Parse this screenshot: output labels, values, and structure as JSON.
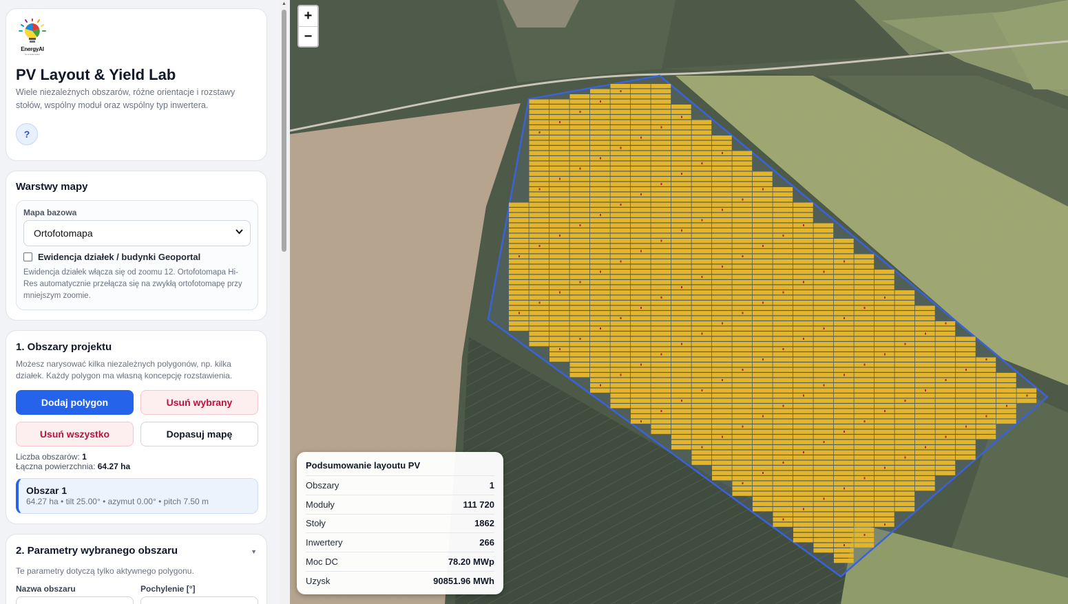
{
  "brand": {
    "logo_text": "EnergyAI",
    "logo_tagline": "for a solar better"
  },
  "header": {
    "title": "PV Layout & Yield Lab",
    "description": "Wiele niezależnych obszarów, różne orientacje i rozstawy stołów, wspólny moduł oraz wspólny typ inwertera.",
    "help_label": "?"
  },
  "layers": {
    "title": "Warstwy mapy",
    "basemap_label": "Mapa bazowa",
    "basemap_value": "Ortofotomapa",
    "cadastre_label": "Ewidencja działek / budynki Geoportal",
    "cadastre_checked": false,
    "hint": "Ewidencja działek włącza się od zoomu 12. Ortofotomapa Hi-Res automatycznie przełącza się na zwykłą ortofotomapę przy mniejszym zoomie."
  },
  "areas": {
    "title": "1. Obszary projektu",
    "description": "Możesz narysować kilka niezależnych polygonów, np. kilka działek. Każdy polygon ma własną koncepcję rozstawienia.",
    "buttons": {
      "add": "Dodaj polygon",
      "remove_selected": "Usuń wybrany",
      "remove_all": "Usuń wszystko",
      "fit_map": "Dopasuj mapę"
    },
    "count_label": "Liczba obszarów:",
    "count_value": "1",
    "total_area_label": "Łączna powierzchnia:",
    "total_area_value": "64.27 ha",
    "items": [
      {
        "name": "Obszar 1",
        "meta": "64.27 ha • tilt 25.00° • azymut 0.00° • pitch 7.50 m"
      }
    ]
  },
  "params": {
    "title": "2. Parametry wybranego obszaru",
    "description": "Te parametry dotyczą tylko aktywnego polygonu.",
    "name_label": "Nazwa obszaru",
    "tilt_label": "Pochylenie [°]"
  },
  "map": {
    "zoom_in": "+",
    "zoom_out": "−",
    "polygon_color": "#3a63d8",
    "panel_color": "#e3b52d"
  },
  "summary": {
    "title": "Podsumowanie layoutu PV",
    "rows": [
      {
        "label": "Obszary",
        "value": "1"
      },
      {
        "label": "Moduły",
        "value": "111 720"
      },
      {
        "label": "Stoły",
        "value": "1862"
      },
      {
        "label": "Inwertery",
        "value": "266"
      },
      {
        "label": "Moc DC",
        "value": "78.20 MWp"
      },
      {
        "label": "Uzysk",
        "value": "90851.96 MWh"
      }
    ]
  }
}
